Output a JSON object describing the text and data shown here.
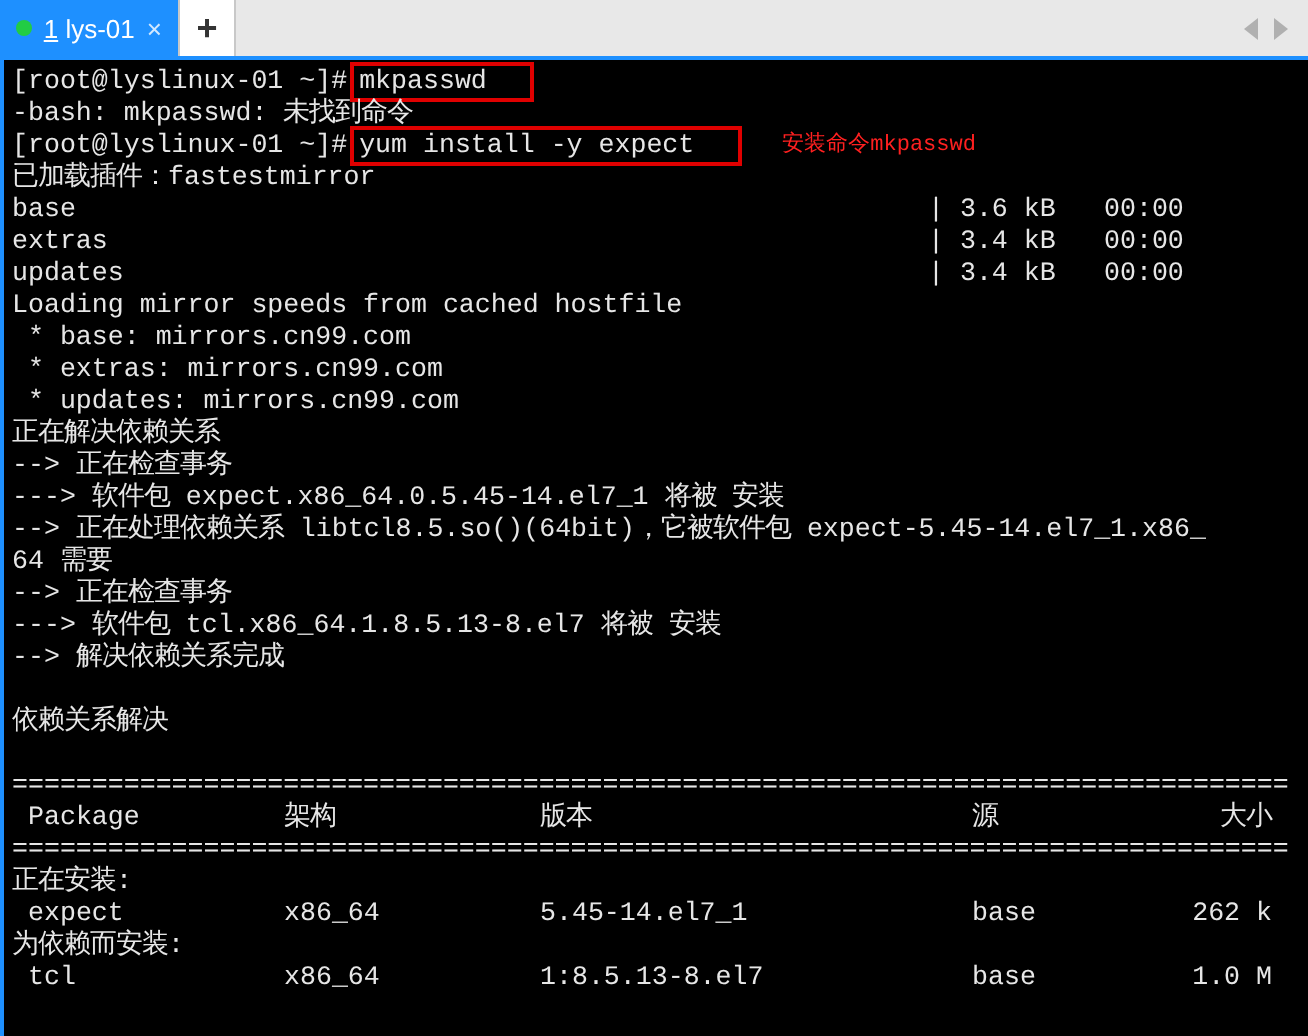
{
  "tabs": [
    {
      "index": "1",
      "name": "lys-01",
      "close": "×",
      "selected": true,
      "connected": true
    }
  ],
  "new_tab": "+",
  "terminal": {
    "lines": [
      {
        "kind": "command",
        "prompt": "[root@lyslinux-01 ~]#",
        "command": "mkpasswd",
        "highlighted": true
      },
      {
        "kind": "text",
        "text": "-bash: mkpasswd: 未找到命令"
      },
      {
        "kind": "command",
        "prompt": "[root@lyslinux-01 ~]#",
        "command": "yum install -y expect",
        "highlighted": true,
        "note": "安装命令mkpasswd"
      },
      {
        "kind": "text",
        "text": "已加载插件：fastestmirror"
      },
      {
        "kind": "repo",
        "cells": [
          "base",
          "| 3.6 kB",
          "00:00"
        ]
      },
      {
        "kind": "repo",
        "cells": [
          "extras",
          "| 3.4 kB",
          "00:00"
        ]
      },
      {
        "kind": "repo",
        "cells": [
          "updates",
          "| 3.4 kB",
          "00:00"
        ]
      },
      {
        "kind": "text",
        "text": "Loading mirror speeds from cached hostfile"
      },
      {
        "kind": "text",
        "text": " * base: mirrors.cn99.com"
      },
      {
        "kind": "text",
        "text": " * extras: mirrors.cn99.com"
      },
      {
        "kind": "text",
        "text": " * updates: mirrors.cn99.com"
      },
      {
        "kind": "text",
        "text": "正在解决依赖关系"
      },
      {
        "kind": "text",
        "text": "--> 正在检查事务"
      },
      {
        "kind": "text",
        "text": "---> 软件包 expect.x86_64.0.5.45-14.el7_1 将被 安装"
      },
      {
        "kind": "text",
        "text": "--> 正在处理依赖关系 libtcl8.5.so()(64bit)，它被软件包 expect-5.45-14.el7_1.x86_"
      },
      {
        "kind": "text",
        "text": "64 需要"
      },
      {
        "kind": "text",
        "text": "--> 正在检查事务"
      },
      {
        "kind": "text",
        "text": "---> 软件包 tcl.x86_64.1.8.5.13-8.el7 将被 安装"
      },
      {
        "kind": "text",
        "text": "--> 解决依赖关系完成"
      },
      {
        "kind": "blank"
      },
      {
        "kind": "text",
        "text": "依赖关系解决"
      },
      {
        "kind": "blank"
      },
      {
        "kind": "text",
        "text": "================================================================================"
      },
      {
        "kind": "table",
        "cells": [
          "Package",
          "架构",
          "版本",
          "源",
          "大小"
        ]
      },
      {
        "kind": "text",
        "text": "================================================================================"
      },
      {
        "kind": "text",
        "text": "正在安装:"
      },
      {
        "kind": "table",
        "cells": [
          "expect",
          "x86_64",
          "5.45-14.el7_1",
          "base",
          "262 k"
        ]
      },
      {
        "kind": "text",
        "text": "为依赖而安装:"
      },
      {
        "kind": "table",
        "cells": [
          "tcl",
          "x86_64",
          "1:8.5.13-8.el7",
          "base",
          "1.0 M"
        ]
      }
    ]
  }
}
